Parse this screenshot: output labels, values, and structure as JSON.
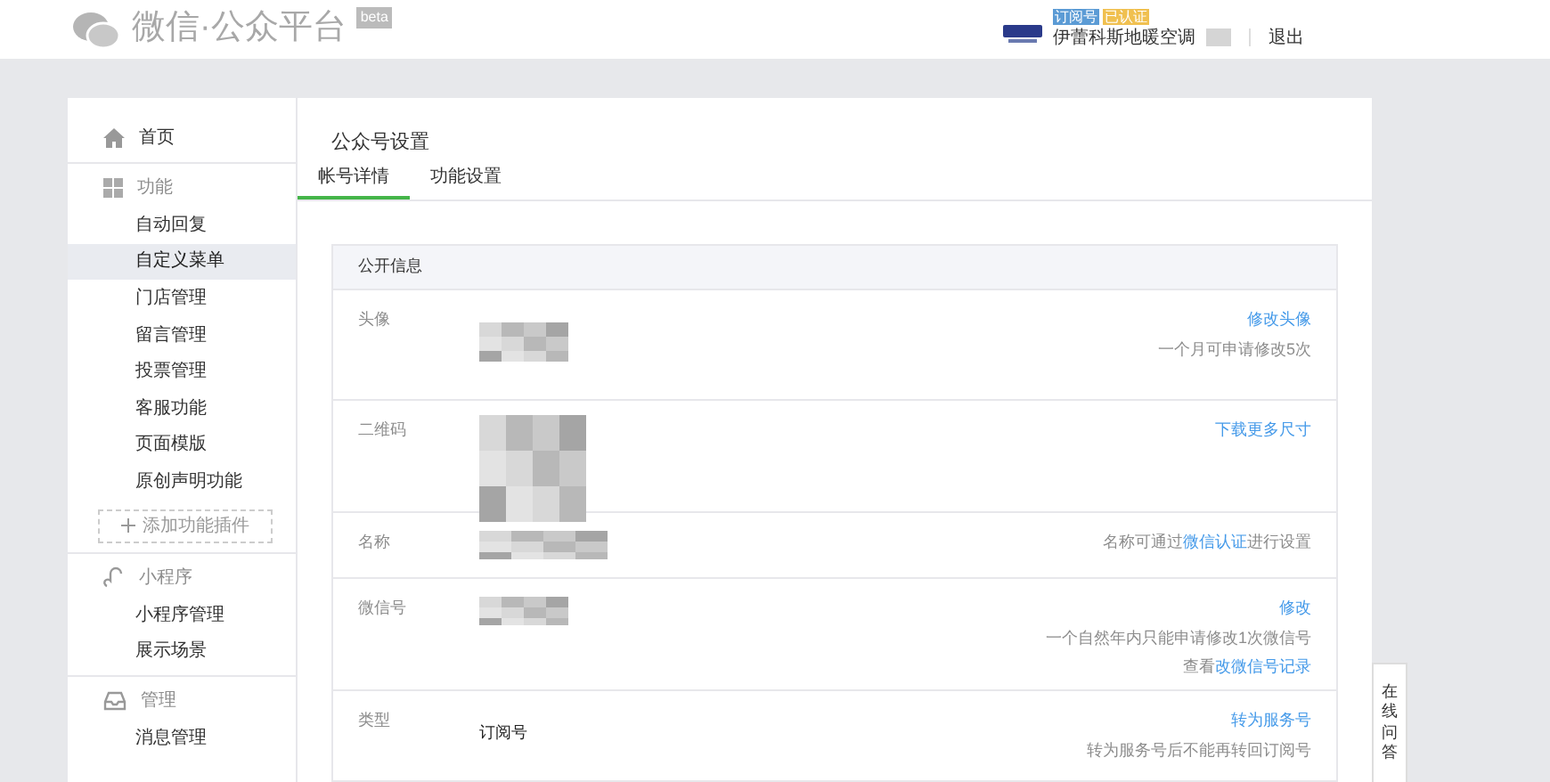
{
  "header": {
    "title": "微信·公众平台",
    "beta": "beta",
    "account_badges": [
      {
        "text": "订阅号",
        "color": "#5b9bd5"
      },
      {
        "text": "已认证",
        "color": "#f0c050"
      }
    ],
    "account_name": "伊蕾科斯地暖空调",
    "logout": "退出"
  },
  "sidebar": {
    "sections": [
      {
        "title": "首页"
      },
      {
        "title": "功能",
        "items": [
          {
            "label": "自动回复",
            "selected": false
          },
          {
            "label": "自定义菜单",
            "selected": true
          },
          {
            "label": "门店管理",
            "selected": false
          },
          {
            "label": "留言管理",
            "selected": false
          },
          {
            "label": "投票管理",
            "selected": false
          },
          {
            "label": "客服功能",
            "selected": false
          },
          {
            "label": "页面模版",
            "selected": false
          },
          {
            "label": "原创声明功能",
            "selected": false
          }
        ],
        "add_button": "添加功能插件"
      },
      {
        "title": "小程序",
        "items": [
          {
            "label": "小程序管理",
            "selected": false
          },
          {
            "label": "展示场景",
            "selected": false
          }
        ]
      },
      {
        "title": "管理",
        "items": [
          {
            "label": "消息管理",
            "selected": false
          }
        ]
      }
    ]
  },
  "page_title": "公众号设置",
  "tabs": [
    {
      "label": "帐号详情",
      "selected": true
    },
    {
      "label": "功能设置",
      "selected": false
    }
  ],
  "panel": {
    "title": "公开信息",
    "rows": [
      {
        "label": "头像",
        "value": {
          "kind": "picture"
        },
        "lines": [
          {
            "kind": "link",
            "parts": [
              {
                "kind": "link",
                "text": "修改头像"
              }
            ]
          },
          {
            "kind": "note",
            "parts": [
              {
                "kind": "text",
                "text": "一个月可申请修改5次"
              }
            ]
          }
        ]
      },
      {
        "label": "二维码",
        "value": {
          "kind": "picture"
        },
        "lines": [
          {
            "kind": "link",
            "parts": [
              {
                "kind": "link",
                "text": "下载更多尺寸"
              }
            ]
          }
        ]
      },
      {
        "label": "名称",
        "value": {
          "kind": "picture"
        },
        "lines": [
          {
            "kind": "note",
            "parts": [
              {
                "kind": "text",
                "text": "名称可通过"
              },
              {
                "kind": "link",
                "text": "微信认证"
              },
              {
                "kind": "text",
                "text": "进行设置"
              }
            ]
          }
        ]
      },
      {
        "label": "微信号",
        "value": {
          "kind": "picture"
        },
        "lines": [
          {
            "kind": "link",
            "parts": [
              {
                "kind": "link",
                "text": "修改"
              }
            ]
          },
          {
            "kind": "note",
            "parts": [
              {
                "kind": "text",
                "text": "一个自然年内只能申请修改1次微信号"
              }
            ]
          },
          {
            "kind": "note",
            "parts": [
              {
                "kind": "text",
                "text": "查看"
              },
              {
                "kind": "link",
                "text": "改微信号记录"
              }
            ]
          }
        ]
      },
      {
        "label": "类型",
        "value": {
          "kind": "text",
          "text": "订阅号"
        },
        "lines": [
          {
            "kind": "link",
            "parts": [
              {
                "kind": "link",
                "text": "转为服务号"
              }
            ]
          },
          {
            "kind": "note",
            "parts": [
              {
                "kind": "text",
                "text": "转为服务号后不能再转回订阅号"
              }
            ]
          }
        ]
      }
    ]
  },
  "help_tab": "在线问答"
}
